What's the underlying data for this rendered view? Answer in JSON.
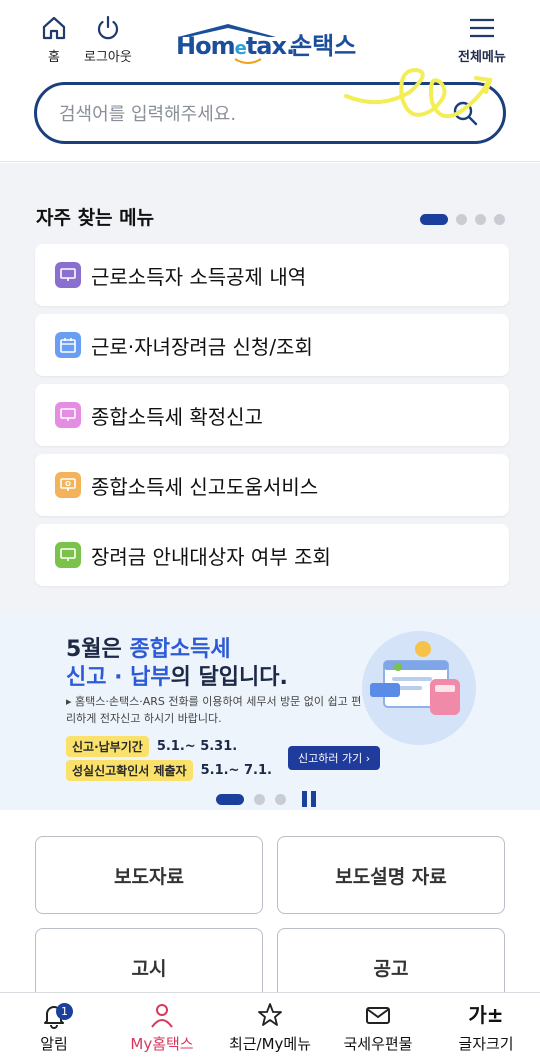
{
  "header": {
    "home_label": "홈",
    "logout_label": "로그아웃",
    "menu_label": "전체메뉴",
    "logo_text_a": "Hom",
    "logo_text_e": "e",
    "logo_text_b": "tax.",
    "logo_sub": "손택스",
    "search_placeholder": "검색어를 입력해주세요."
  },
  "frequent": {
    "title": "자주 찾는 메뉴",
    "items": [
      {
        "label": "근로소득자 소득공제 내역",
        "icon": "monitor-icon",
        "color": "#8a6fcf"
      },
      {
        "label": "근로·자녀장려금 신청/조회",
        "icon": "calendar-icon",
        "color": "#6a9ef2"
      },
      {
        "label": "종합소득세 확정신고",
        "icon": "monitor-icon",
        "color": "#e58ce3"
      },
      {
        "label": "종합소득세 신고도움서비스",
        "icon": "monitor-search-icon",
        "color": "#f2b35a"
      },
      {
        "label": "장려금 안내대상자 여부 조회",
        "icon": "monitor-icon",
        "color": "#7ac24a"
      }
    ]
  },
  "banner": {
    "title1_a": "5월은 ",
    "title1_hl": "종합소득세",
    "title2_hl": "신고 · 납부",
    "title2_b": "의 달입니다.",
    "desc": "▸ 홈택스·손택스·ARS 전화를 이용하여 세무서 방문 없이 쉽고 편리하게 전자신고 하시기 바랍니다.",
    "row1_tag": "신고·납부기간",
    "row1_date": "5.1.~ 5.31.",
    "row2_tag": "성실신고확인서 제출자",
    "row2_date": "5.1.~ 7.1.",
    "button": "신고하러 가기 ›"
  },
  "links": {
    "press": "보도자료",
    "press_explain": "보도설명 자료",
    "notice": "고시",
    "announcement": "공고"
  },
  "bottom_nav": {
    "alarm": "알림",
    "alarm_badge": "1",
    "my_hometax": "My홈택스",
    "recent": "최근/My메뉴",
    "mail": "국세우편물",
    "font_size": "글자크기",
    "font_size_icon": "가±"
  }
}
